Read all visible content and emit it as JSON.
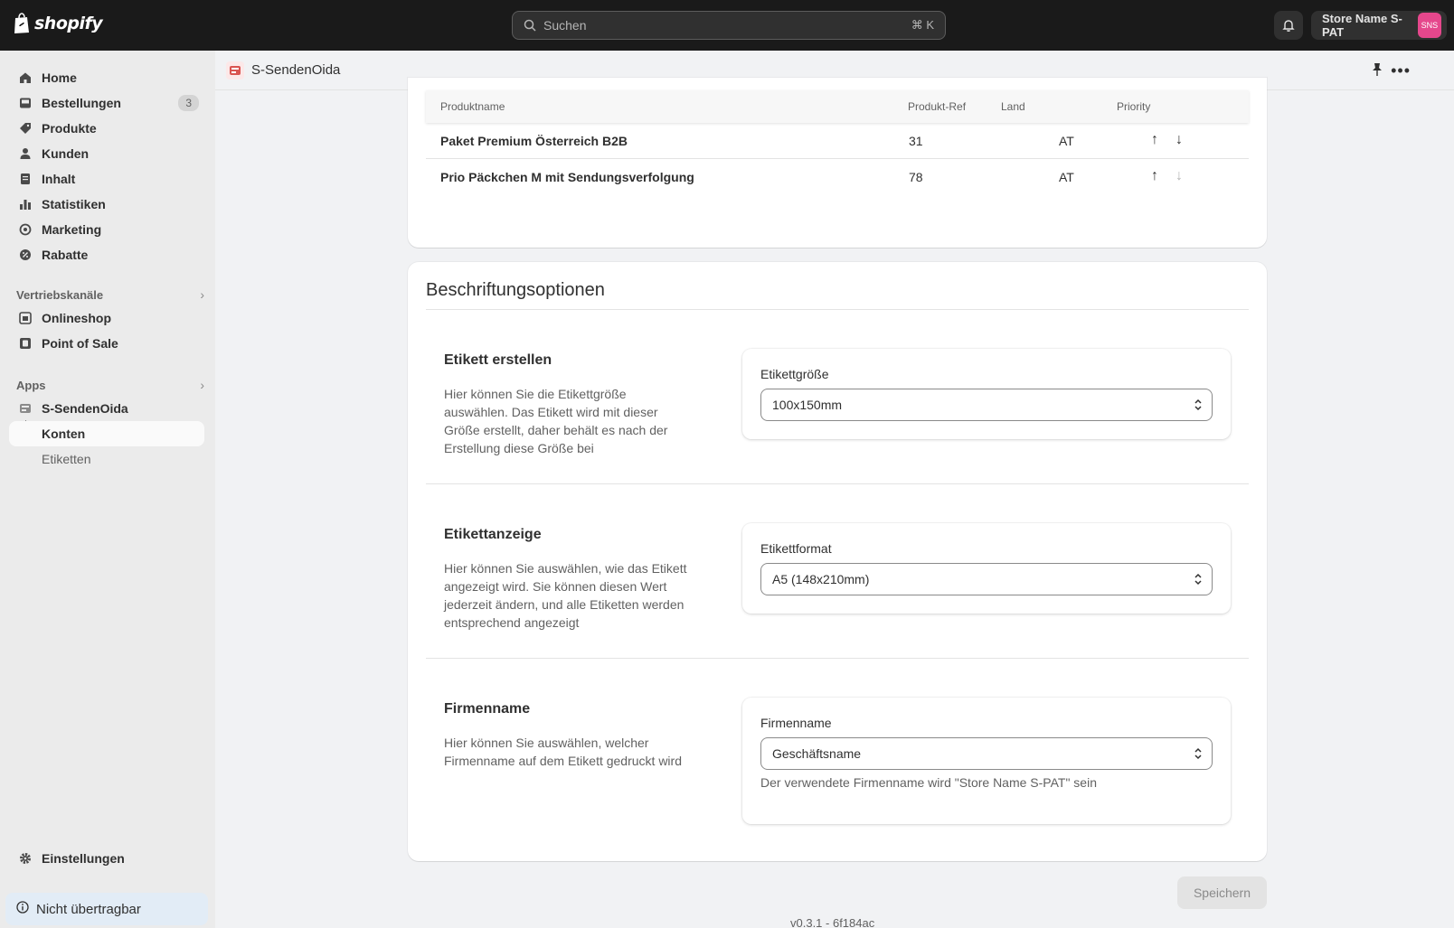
{
  "topbar": {
    "brand": "shopify",
    "search_placeholder": "Suchen",
    "search_shortcut": "⌘ K",
    "store_name": "Store Name S-PAT",
    "store_initials": "SNS"
  },
  "sidebar": {
    "items": [
      {
        "label": "Home",
        "icon": "home-icon"
      },
      {
        "label": "Bestellungen",
        "icon": "inbox-icon",
        "badge": "3"
      },
      {
        "label": "Produkte",
        "icon": "tag-icon"
      },
      {
        "label": "Kunden",
        "icon": "person-icon"
      },
      {
        "label": "Inhalt",
        "icon": "document-icon"
      },
      {
        "label": "Statistiken",
        "icon": "bar-chart-icon"
      },
      {
        "label": "Marketing",
        "icon": "target-icon"
      },
      {
        "label": "Rabatte",
        "icon": "discount-icon"
      }
    ],
    "sales_channels_label": "Vertriebskanäle",
    "channels": [
      {
        "label": "Onlineshop",
        "icon": "store-icon"
      },
      {
        "label": "Point of Sale",
        "icon": "pos-icon"
      }
    ],
    "apps_label": "Apps",
    "app": {
      "label": "S-SendenOida"
    },
    "app_subitems": [
      "Konten",
      "Etiketten"
    ],
    "settings_label": "Einstellungen",
    "non_transferable_label": "Nicht übertragbar"
  },
  "appbar": {
    "title": "S-SendenOida"
  },
  "products_table": {
    "headers": [
      "Produktname",
      "Produkt-Ref",
      "Land",
      "Priority"
    ],
    "rows": [
      {
        "name": "Paket Premium Österreich B2B",
        "ref": "31",
        "country": "AT"
      },
      {
        "name": "Prio Päckchen M mit Sendungsverfolgung",
        "ref": "78",
        "country": "AT"
      }
    ]
  },
  "label_options": {
    "title": "Beschriftungsoptionen",
    "sections": [
      {
        "title": "Etikett erstellen",
        "description": "Hier können Sie die Etikettgröße auswählen. Das Etikett wird mit dieser Größe erstellt, daher behält es nach der Erstellung diese Größe bei",
        "field_label": "Etikettgröße",
        "value": "100x150mm"
      },
      {
        "title": "Etikettanzeige",
        "description": "Hier können Sie auswählen, wie das Etikett angezeigt wird. Sie können diesen Wert jederzeit ändern, und alle Etiketten werden entsprechend angezeigt",
        "field_label": "Etikettformat",
        "value": "A5 (148x210mm)"
      },
      {
        "title": "Firmenname",
        "description": "Hier können Sie auswählen, welcher Firmenname auf dem Etikett gedruckt wird",
        "field_label": "Firmenname",
        "value": "Geschäftsname",
        "help": "Der verwendete Firmenname wird \"Store Name S-PAT\" sein"
      }
    ]
  },
  "footer": {
    "save_label": "Speichern",
    "version": "v0.3.1 - 6f184ac"
  }
}
